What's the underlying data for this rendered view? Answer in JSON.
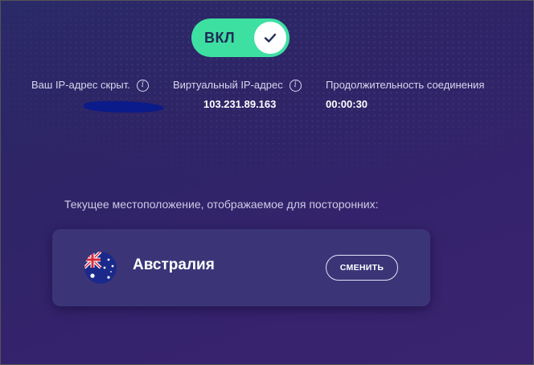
{
  "toggle": {
    "label": "ВКЛ",
    "state": "on",
    "color": "#3ee0a2",
    "icon": "check-icon"
  },
  "info": [
    {
      "label": "Ваш IP-адрес скрыт.",
      "value": "",
      "has_info_icon": true
    },
    {
      "label": "Виртуальный IP-адрес",
      "value": "103.231.89.163",
      "has_info_icon": true
    },
    {
      "label": "Продолжительность соединения",
      "value": "00:00:30",
      "has_info_icon": false
    }
  ],
  "info_icon_glyph": "i",
  "location": {
    "heading": "Текущее местоположение, отображаемое для посторонних:",
    "country": "Австралия",
    "flag_icon": "australia-flag-icon",
    "change_button": "СМЕНИТЬ"
  },
  "colors": {
    "background": "#2e2466",
    "card": "#3b3578",
    "accent": "#3ee0a2"
  }
}
